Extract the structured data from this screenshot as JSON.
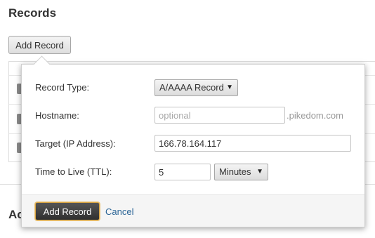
{
  "section": {
    "title": "Records",
    "add_button_label": "Add Record",
    "next_section_title": "Ac"
  },
  "popover": {
    "record_type": {
      "label": "Record Type:",
      "selected": "A/AAAA Record",
      "caret": "▼"
    },
    "hostname": {
      "label": "Hostname:",
      "value": "",
      "placeholder": "optional",
      "suffix": ".pikedom.com"
    },
    "target": {
      "label": "Target (IP Address):",
      "value": "166.78.164.117"
    },
    "ttl": {
      "label": "Time to Live (TTL):",
      "value": "5",
      "unit_selected": "Minutes",
      "caret": "▼"
    },
    "footer": {
      "submit_label": "Add Record",
      "cancel_label": "Cancel"
    }
  },
  "colors": {
    "link": "#2a6496",
    "primary_button": "#3a3a3a",
    "focus_ring": "#d9a441"
  }
}
